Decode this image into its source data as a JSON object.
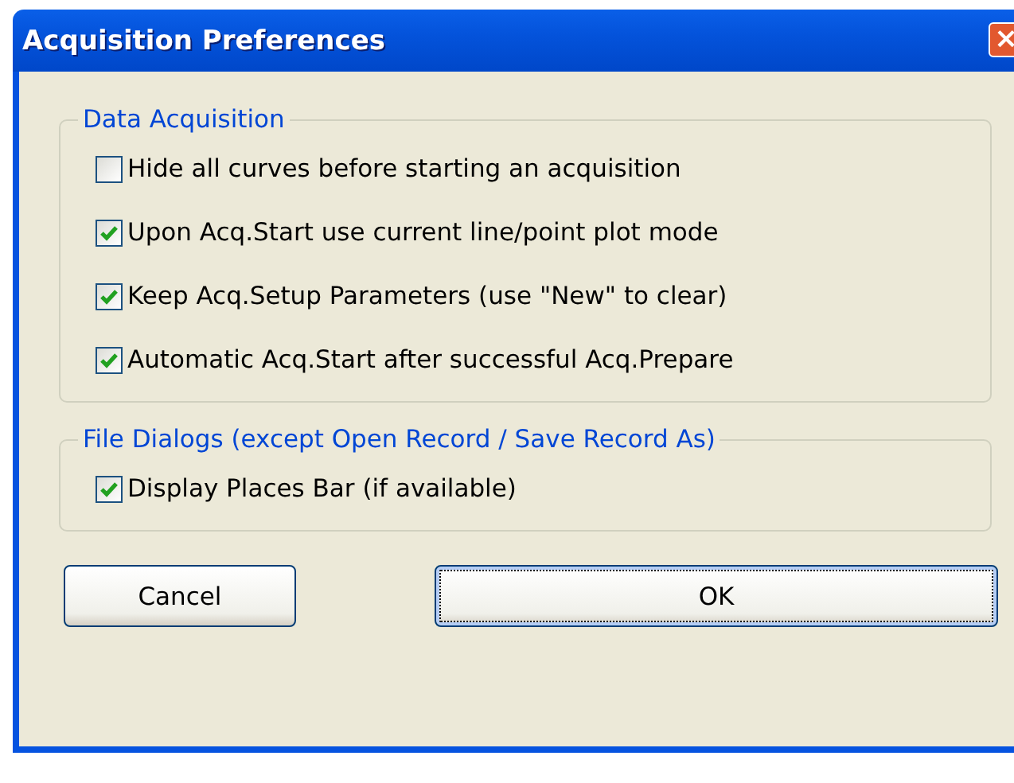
{
  "window": {
    "title": "Acquisition Preferences",
    "close": "×"
  },
  "groups": [
    {
      "title": "Data Acquisition",
      "options": [
        {
          "label": "Hide all curves before starting an acquisition",
          "checked": false
        },
        {
          "label": "Upon Acq.Start use current line/point plot mode",
          "checked": true
        },
        {
          "label": "Keep Acq.Setup Parameters (use \"New\" to clear)",
          "checked": true
        },
        {
          "label": "Automatic Acq.Start after successful Acq.Prepare",
          "checked": true
        }
      ]
    },
    {
      "title": "File Dialogs (except Open Record / Save Record As)",
      "options": [
        {
          "label": "Display Places Bar (if available)",
          "checked": true
        }
      ]
    }
  ],
  "buttons": [
    {
      "label": "Cancel",
      "focused": false
    },
    {
      "label": "OK",
      "focused": true
    }
  ]
}
